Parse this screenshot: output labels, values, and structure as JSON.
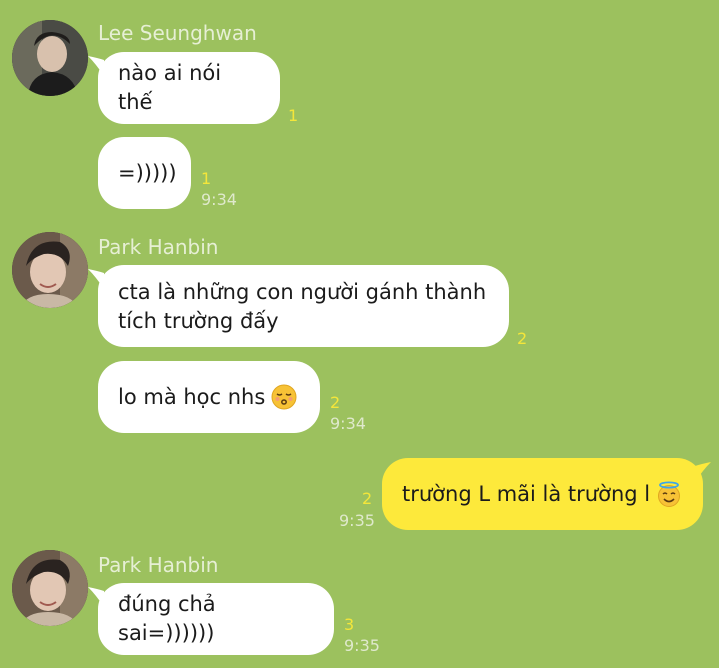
{
  "colors": {
    "background": "#9cc15e",
    "incoming_bubble": "#ffffff",
    "outgoing_bubble": "#fde93b",
    "unread_count": "#f4e63a",
    "sender_name": "#e6efd4",
    "timestamp": "#dfe9cc"
  },
  "messages": [
    {
      "sender": "Lee Seunghwan",
      "avatar_icon": "avatar-lee-seunghwan",
      "bubbles": [
        {
          "text": "nào ai nói thế",
          "unread": "1",
          "time": ""
        },
        {
          "text": "=)))))",
          "unread": "1",
          "time": "9:34"
        }
      ]
    },
    {
      "sender": "Park Hanbin",
      "avatar_icon": "avatar-park-hanbin",
      "bubbles": [
        {
          "text_line1": "cta là những con người gánh thành",
          "text_line2": "tích trường đấy",
          "unread": "2",
          "time": ""
        },
        {
          "text": "lo mà học nhs",
          "emoji": "kissing-face-emoji",
          "unread": "2",
          "time": "9:34"
        }
      ]
    },
    {
      "sender": "me",
      "bubbles": [
        {
          "text": "trường L mãi là trường l",
          "emoji": "smiling-face-with-halo-emoji",
          "unread": "2",
          "time": "9:35"
        }
      ]
    },
    {
      "sender": "Park Hanbin",
      "avatar_icon": "avatar-park-hanbin",
      "bubbles": [
        {
          "text": "đúng chả sai=))))))",
          "unread": "3",
          "time": "9:35"
        }
      ]
    }
  ]
}
